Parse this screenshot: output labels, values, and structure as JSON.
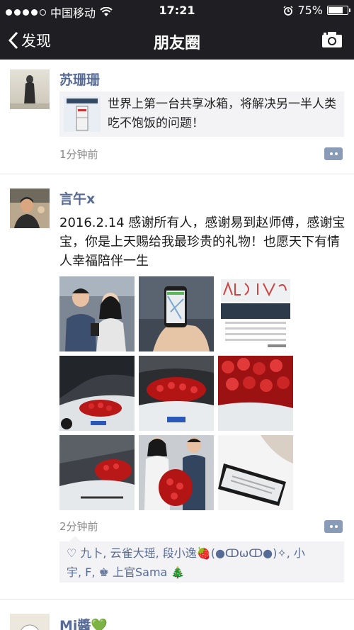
{
  "status_bar": {
    "carrier": "中国移动",
    "time": "17:21",
    "battery": "75%",
    "battery_level": 0.75
  },
  "nav": {
    "back_label": "发现",
    "title": "朋友圈"
  },
  "posts": [
    {
      "name": "苏珊珊",
      "link_text": "世界上第一台共享冰箱，将解决另一半人类吃不饱饭的问题！",
      "time": "1分钟前"
    },
    {
      "name": "言午x",
      "text": "2016.2.14 感谢所有人，感谢易到赵师傅，感谢宝宝，你是上天赐给我最珍贵的礼物！也愿天下有情人幸福陪伴一生",
      "time": "2分钟前",
      "likes_line1": "♡ 九卜, 云雀大瑶, 段小逸🍓(●ↀωↀ●)✧, 小",
      "likes_line2": "宇, F, ♚ 上官Sama 🎄"
    },
    {
      "name": "Mi醬",
      "name_emoji": "💚"
    }
  ],
  "colors": {
    "nav_bg": "#1f1f23",
    "name": "#576b95",
    "card_bg": "#f3f3f5"
  }
}
